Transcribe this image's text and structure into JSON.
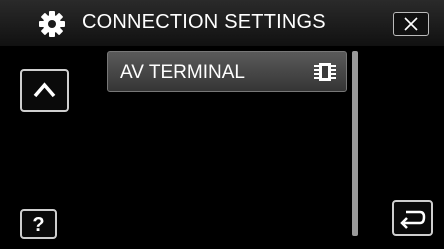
{
  "header": {
    "title": "CONNECTION SETTINGS",
    "icon": "gear-icon"
  },
  "menu": {
    "items": [
      {
        "label": "AV TERMINAL",
        "icon": "av-connector-icon"
      }
    ]
  },
  "buttons": {
    "close_icon": "close-icon",
    "up_icon": "chevron-up-icon",
    "help_label": "?",
    "back_icon": "return-arrow-icon"
  },
  "colors": {
    "background": "#000000",
    "item_background": "#4a4a4a",
    "text": "#ffffff",
    "button_border": "#cfcfcf"
  }
}
